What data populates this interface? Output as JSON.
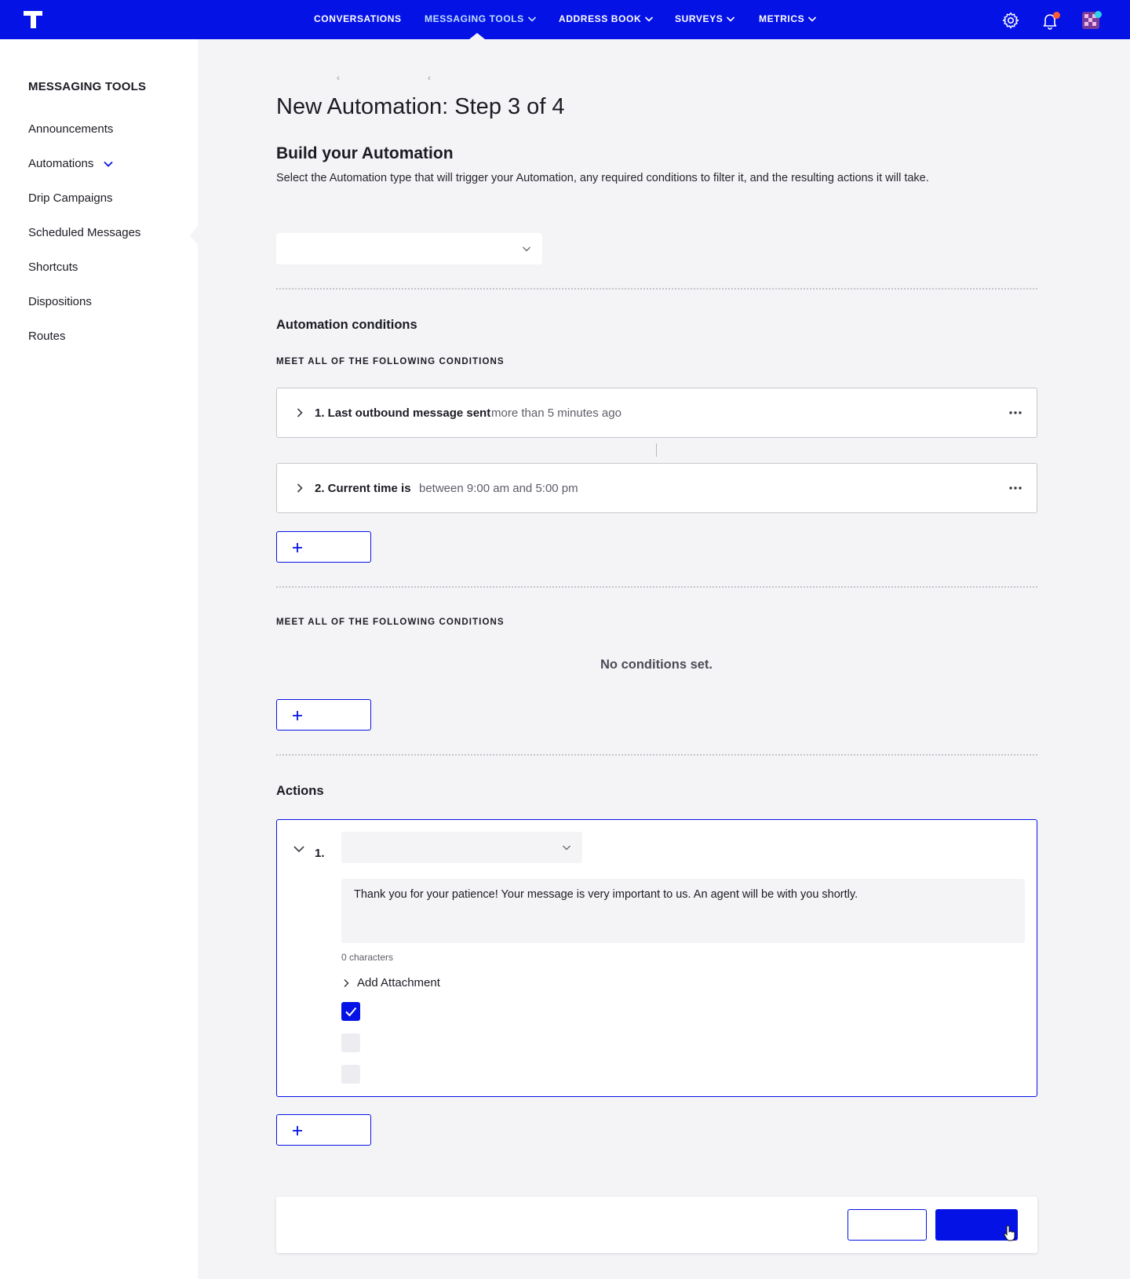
{
  "topnav": {
    "items": [
      {
        "label": "CONVERSATIONS",
        "has_dropdown": false,
        "active": false
      },
      {
        "label": "MESSAGING TOOLS",
        "has_dropdown": true,
        "active": true
      },
      {
        "label": "ADDRESS BOOK",
        "has_dropdown": true,
        "active": false
      },
      {
        "label": "SURVEYS",
        "has_dropdown": true,
        "active": false
      },
      {
        "label": "METRICS",
        "has_dropdown": true,
        "active": false
      }
    ],
    "icons": [
      "logo-icon",
      "gear-icon",
      "bell-icon",
      "avatar-icon"
    ],
    "notification_dot_color": "#ff5a36",
    "avatar_dot_color": "#2ad3e8"
  },
  "sidebar": {
    "title": "MESSAGING TOOLS",
    "items": [
      {
        "label": "Announcements"
      },
      {
        "label": "Automations",
        "expandable": true
      },
      {
        "label": "Drip Campaigns"
      },
      {
        "label": "Scheduled Messages"
      },
      {
        "label": "Shortcuts"
      },
      {
        "label": "Dispositions"
      },
      {
        "label": "Routes"
      }
    ]
  },
  "main": {
    "title": "New Automation: Step 3 of 4",
    "section_title": "Build your Automation",
    "section_desc": "Select the Automation type that will trigger your Automation, any required conditions to filter it, and the resulting actions it will take.",
    "trigger_select": {
      "value": ""
    },
    "conditions": {
      "heading": "Automation conditions",
      "group1": {
        "eyebrow": "MEET ALL OF THE FOLLOWING CONDITIONS",
        "items": [
          {
            "name": "1. Last outbound message sent",
            "value": "more than 5 minutes ago"
          },
          {
            "name": "2. Current time is",
            "value": "between 9:00 am and 5:00 pm"
          }
        ]
      },
      "group2": {
        "eyebrow": "MEET ALL OF THE FOLLOWING CONDITIONS",
        "empty_text": "No conditions set."
      }
    },
    "actions": {
      "heading": "Actions",
      "items": [
        {
          "number": "1.",
          "select_value": "",
          "message": "Thank you for your patience! Your message is very important to us. An agent will be with you shortly.",
          "char_count": "0 characters",
          "attachment_label": "Add Attachment",
          "checkboxes": [
            true,
            false,
            false
          ]
        }
      ]
    }
  },
  "colors": {
    "brand": "#0512e6",
    "background": "#f4f4f7"
  }
}
